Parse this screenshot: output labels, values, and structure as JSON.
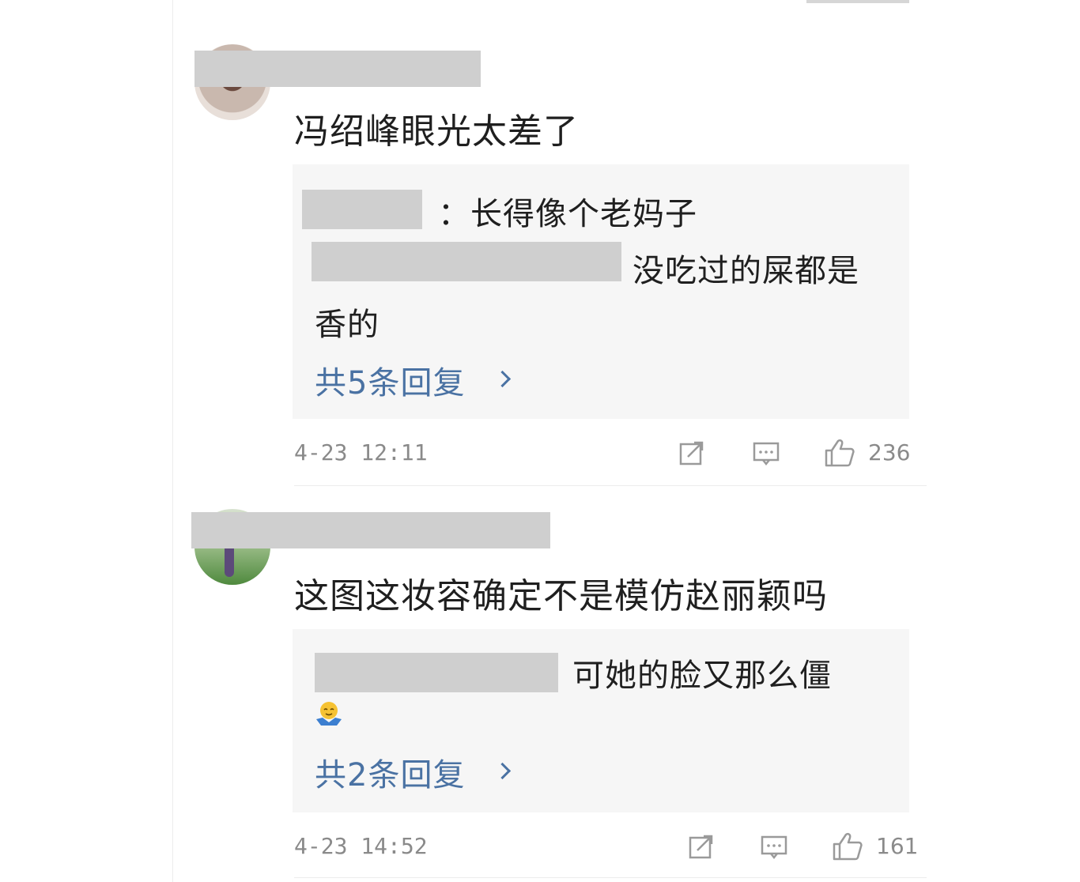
{
  "comments": [
    {
      "text": "冯绍峰眼光太差了",
      "replies": [
        {
          "text": "：长得像个老妈子"
        },
        {
          "text": "没吃过的屎都是"
        },
        {
          "text": "香的"
        }
      ],
      "more_replies": "共5条回复",
      "time": "4-23 12:11",
      "likes": "236"
    },
    {
      "text": "这图这妆容确定不是模仿赵丽颖吗",
      "replies": [
        {
          "text": "可她的脸又那么僵"
        }
      ],
      "more_replies": "共2条回复",
      "time": "4-23 14:52",
      "likes": "161"
    }
  ],
  "icons": {
    "share": "share-icon",
    "comment": "comment-icon",
    "like": "thumbs-up-icon",
    "chevron": "chevron-right-icon"
  },
  "colors": {
    "link": "#4a72a3",
    "text": "#1f1f1f",
    "meta": "#8a8a8a",
    "reply_bg": "#f6f6f6"
  }
}
